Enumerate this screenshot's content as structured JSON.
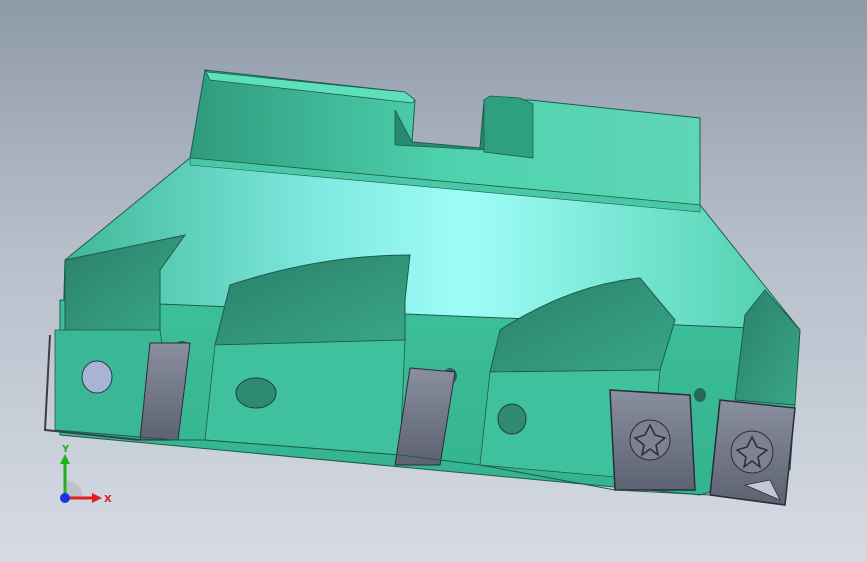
{
  "viewport": {
    "background_top": "#8f9aa9",
    "background_bottom": "#d6dbe3"
  },
  "model": {
    "body_color": "#3dc7a0",
    "highlight_color": "#8ff7f0",
    "insert_color": "#6f7484"
  },
  "triad": {
    "x_label": "X",
    "y_label": "Y",
    "x_color": "#e02020",
    "y_color": "#20b020",
    "z_color": "#2030e0"
  }
}
